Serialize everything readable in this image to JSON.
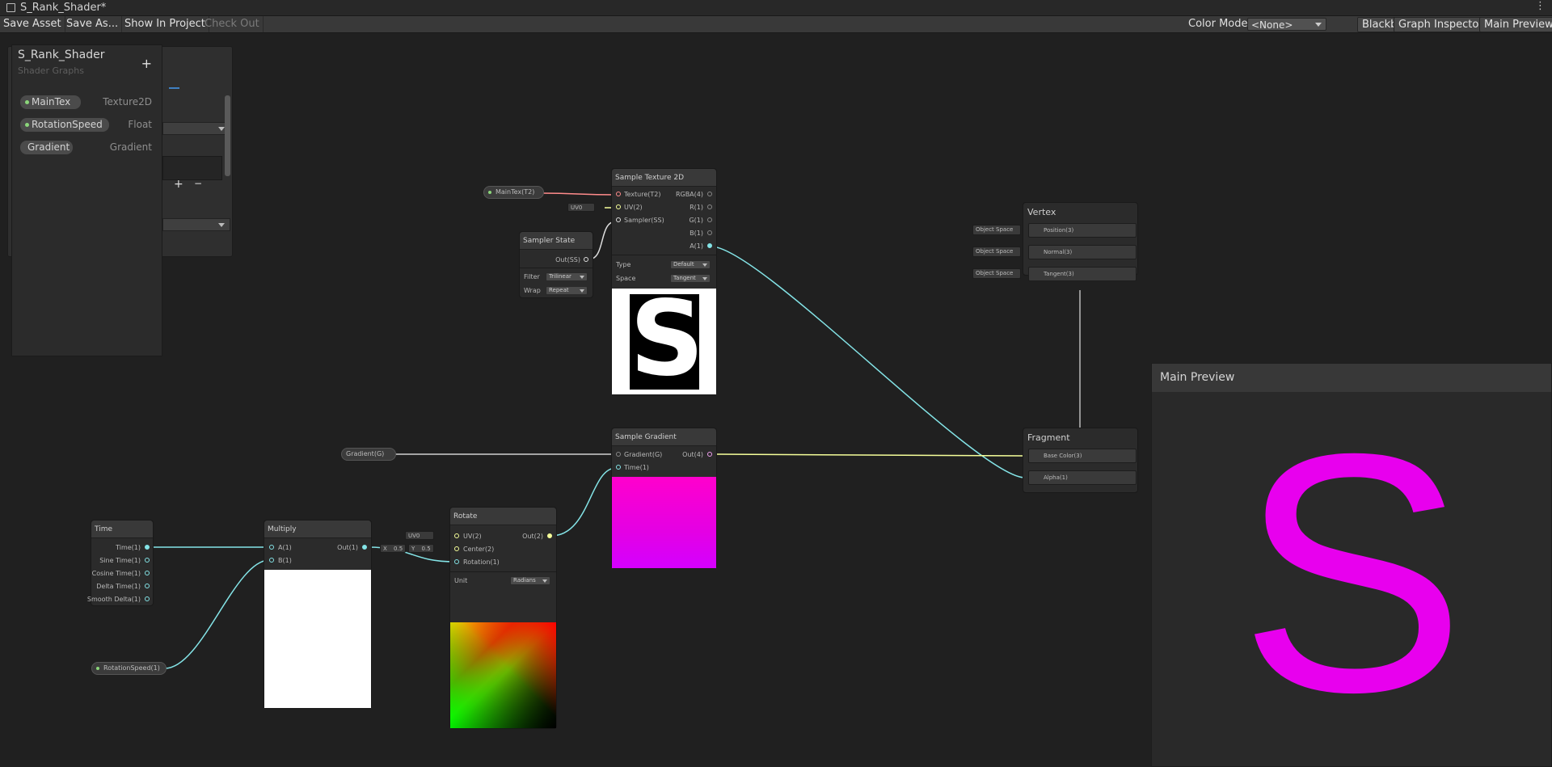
{
  "window": {
    "title": "S_Rank_Shader*",
    "menu_icon": "kebab-menu-icon"
  },
  "toolbar": {
    "save_asset": "Save Asset",
    "save_as": "Save As...",
    "show_in_project": "Show In Project",
    "check_out": "Check Out",
    "color_mode_label": "Color Mode",
    "color_mode_value": "<None>",
    "blackboard": "Blackboard",
    "graph_inspector": "Graph Inspector",
    "main_preview": "Main Preview"
  },
  "blackboard": {
    "title": "S_Rank_Shader",
    "subtitle": "Shader Graphs",
    "add": "+",
    "properties": [
      {
        "name": "MainTex",
        "type": "Texture2D"
      },
      {
        "name": "RotationSpeed",
        "type": "Float"
      },
      {
        "name": "Gradient",
        "type": "Gradient"
      }
    ]
  },
  "inspector": {
    "add": "+",
    "remove": "−"
  },
  "properties_on_graph": {
    "maintex": "MainTex(T2)",
    "gradient": "Gradient(G)",
    "rotation_speed": "RotationSpeed(1)"
  },
  "nodes": {
    "sample_texture": {
      "title": "Sample Texture 2D",
      "inputs": [
        "Texture(T2)",
        "UV(2)",
        "Sampler(SS)"
      ],
      "outputs": [
        "RGBA(4)",
        "R(1)",
        "G(1)",
        "B(1)",
        "A(1)"
      ],
      "uv_value": "UV0",
      "type_label": "Type",
      "type_value": "Default",
      "space_label": "Space",
      "space_value": "Tangent",
      "preview_glyph": "S"
    },
    "sampler_state": {
      "title": "Sampler State",
      "output": "Out(SS)",
      "filter_label": "Filter",
      "filter_value": "Trilinear",
      "wrap_label": "Wrap",
      "wrap_value": "Repeat"
    },
    "vertex": {
      "title": "Vertex",
      "ports": [
        "Position(3)",
        "Normal(3)",
        "Tangent(3)"
      ],
      "space": "Object Space"
    },
    "fragment": {
      "title": "Fragment",
      "ports": [
        "Base Color(3)",
        "Alpha(1)"
      ]
    },
    "sample_gradient": {
      "title": "Sample Gradient",
      "inputs": [
        "Gradient(G)",
        "Time(1)"
      ],
      "output": "Out(4)"
    },
    "time": {
      "title": "Time",
      "outputs": [
        "Time(1)",
        "Sine Time(1)",
        "Cosine Time(1)",
        "Delta Time(1)",
        "Smooth Delta(1)"
      ]
    },
    "multiply": {
      "title": "Multiply",
      "inputs": [
        "A(1)",
        "B(1)"
      ],
      "output": "Out(1)"
    },
    "rotate": {
      "title": "Rotate",
      "inputs": [
        "UV(2)",
        "Center(2)",
        "Rotation(1)"
      ],
      "output": "Out(2)",
      "uv_value": "UV0",
      "center_x_label": "X",
      "center_x": "0.5",
      "center_y_label": "Y",
      "center_y": "0.5",
      "unit_label": "Unit",
      "unit_value": "Radians"
    }
  },
  "main_preview": {
    "title": "Main Preview",
    "glyph": "S",
    "color": "#e800ee"
  },
  "colors": {
    "canvas": "#202020",
    "node": "#2b2b2b",
    "wire_float": "#84e4e7",
    "wire_texture": "#ff8b8b",
    "wire_vector": "#f6ff9a",
    "wire_gradient": "#c8c8c8",
    "magenta": "#ff00cc",
    "violet": "#d400ff"
  }
}
